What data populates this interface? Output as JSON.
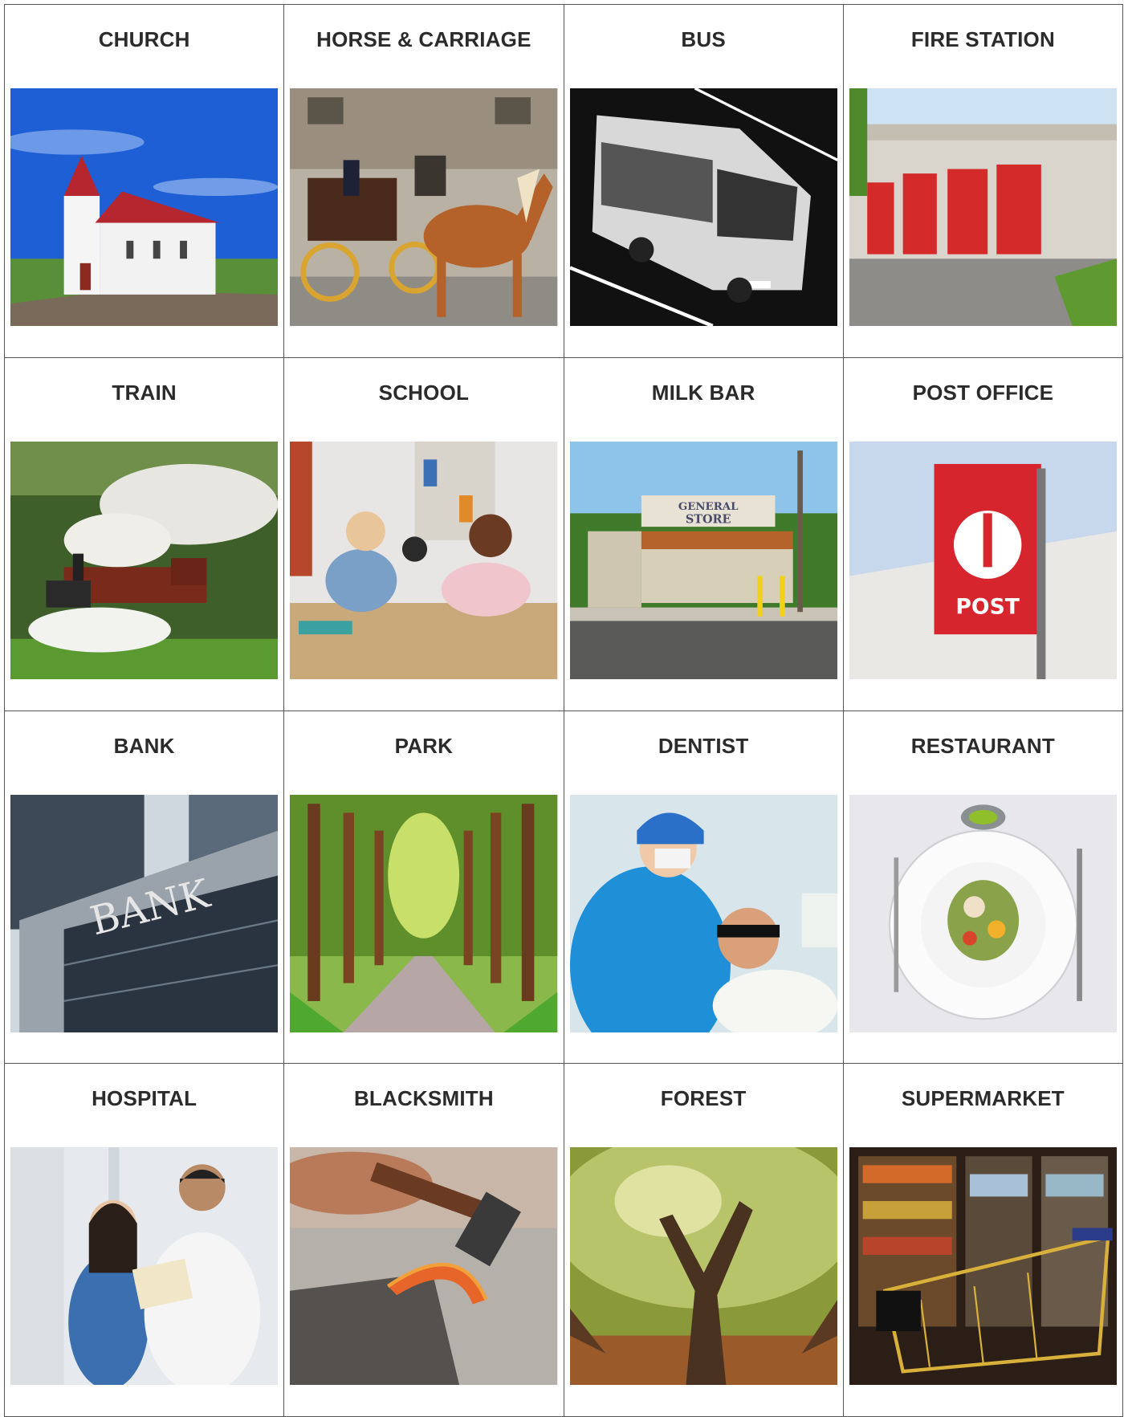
{
  "cards": [
    {
      "label": "CHURCH",
      "image": "church-photo"
    },
    {
      "label": "HORSE & CARRIAGE",
      "image": "horse-carriage-photo"
    },
    {
      "label": "BUS",
      "image": "bus-photo"
    },
    {
      "label": "FIRE STATION",
      "image": "fire-station-photo"
    },
    {
      "label": "TRAIN",
      "image": "steam-train-photo"
    },
    {
      "label": "SCHOOL",
      "image": "classroom-photo"
    },
    {
      "label": "MILK BAR",
      "image": "general-store-photo",
      "sign_text": [
        "GENERAL",
        "STORE"
      ]
    },
    {
      "label": "POST OFFICE",
      "image": "post-sign-photo",
      "sign_text": "POST"
    },
    {
      "label": "BANK",
      "image": "bank-building-photo",
      "sign_text": "BANK"
    },
    {
      "label": "PARK",
      "image": "park-path-photo"
    },
    {
      "label": "DENTIST",
      "image": "dentist-photo"
    },
    {
      "label": "RESTAURANT",
      "image": "restaurant-plate-photo"
    },
    {
      "label": "HOSPITAL",
      "image": "hospital-staff-photo"
    },
    {
      "label": "BLACKSMITH",
      "image": "blacksmith-anvil-photo"
    },
    {
      "label": "FOREST",
      "image": "forest-tree-photo"
    },
    {
      "label": "SUPERMARKET",
      "image": "shopping-trolley-photo"
    }
  ]
}
